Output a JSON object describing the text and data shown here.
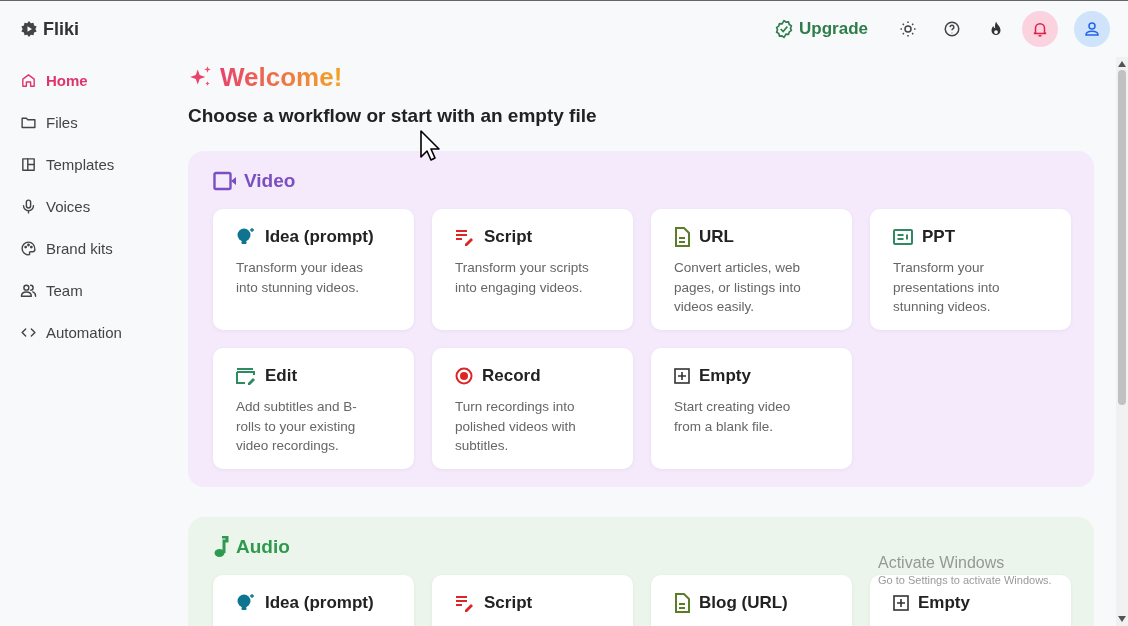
{
  "brand": {
    "name": "Fliki"
  },
  "sidebar": {
    "items": [
      {
        "label": "Home",
        "kind": "home",
        "selected": true
      },
      {
        "label": "Files",
        "kind": "folder",
        "selected": false
      },
      {
        "label": "Templates",
        "kind": "templates",
        "selected": false
      },
      {
        "label": "Voices",
        "kind": "mic",
        "selected": false
      },
      {
        "label": "Brand kits",
        "kind": "palette",
        "selected": false
      },
      {
        "label": "Team",
        "kind": "team",
        "selected": false
      },
      {
        "label": "Automation",
        "kind": "code",
        "selected": false
      }
    ]
  },
  "topbar": {
    "upgrade": "Upgrade"
  },
  "welcome": {
    "title": "Welcome!",
    "subtitle": "Choose a workflow or start with an empty file"
  },
  "sections": [
    {
      "kind": "video",
      "title": "Video",
      "cards": [
        {
          "kind": "idea",
          "title": "Idea (prompt)",
          "description": "Transform your ideas into stunning videos."
        },
        {
          "kind": "script",
          "title": "Script",
          "description": "Transform your scripts into engaging videos."
        },
        {
          "kind": "url",
          "title": "URL",
          "description": "Convert articles, web pages, or listings into videos easily."
        },
        {
          "kind": "ppt",
          "title": "PPT",
          "description": "Transform your presentations into stunning videos."
        },
        {
          "kind": "edit",
          "title": "Edit",
          "description": "Add subtitles and B-rolls to your existing video recordings."
        },
        {
          "kind": "record",
          "title": "Record",
          "description": "Turn recordings into polished videos with subtitles."
        },
        {
          "kind": "empty",
          "title": "Empty",
          "description": "Start creating video from a blank file."
        }
      ]
    },
    {
      "kind": "audio",
      "title": "Audio",
      "cards": [
        {
          "kind": "idea",
          "title": "Idea (prompt)"
        },
        {
          "kind": "script",
          "title": "Script"
        },
        {
          "kind": "url",
          "title": "Blog (URL)"
        },
        {
          "kind": "empty",
          "title": "Empty"
        }
      ]
    }
  ],
  "os_notice": {
    "title": "Activate Windows",
    "subtitle": "Go to Settings to activate Windows."
  }
}
